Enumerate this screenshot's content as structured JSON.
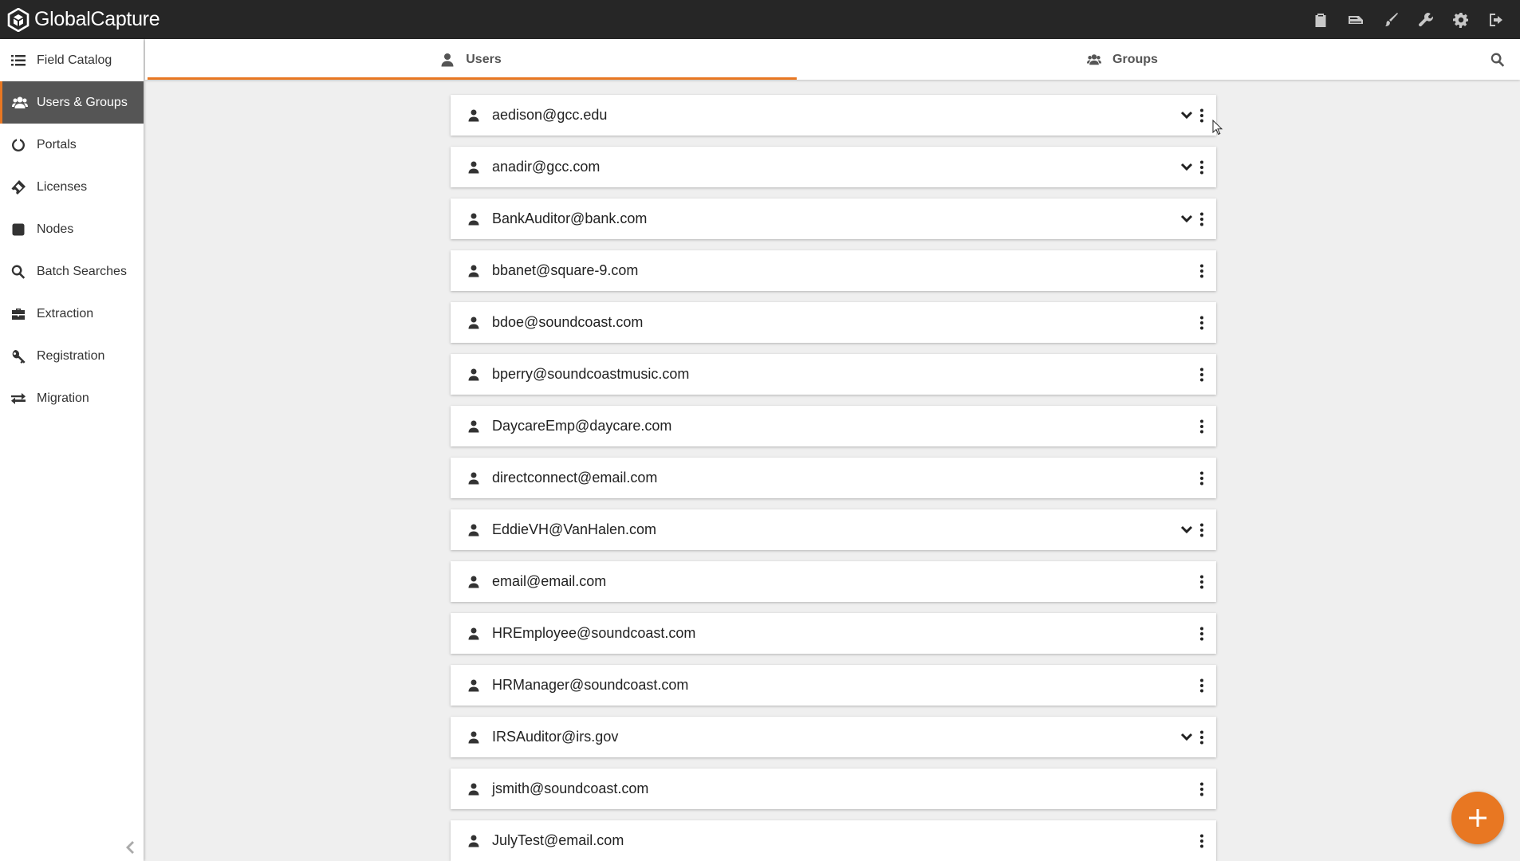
{
  "app": {
    "title": "GlobalCapture",
    "accent_color": "#e87722",
    "topbar_color": "#262626"
  },
  "toolbar": {
    "icons": [
      "clipboard-check-icon",
      "scanner-icon",
      "brush-icon",
      "wrench-icon",
      "gear-icon",
      "sign-out-icon"
    ]
  },
  "sidebar": {
    "items": [
      {
        "label": "Field Catalog",
        "icon": "list-icon"
      },
      {
        "label": "Users & Groups",
        "icon": "users-icon",
        "active": true
      },
      {
        "label": "Portals",
        "icon": "circle-notch-icon"
      },
      {
        "label": "Licenses",
        "icon": "ticket-icon"
      },
      {
        "label": "Nodes",
        "icon": "square-icon"
      },
      {
        "label": "Batch Searches",
        "icon": "search-icon"
      },
      {
        "label": "Extraction",
        "icon": "briefcase-icon"
      },
      {
        "label": "Registration",
        "icon": "key-icon"
      },
      {
        "label": "Migration",
        "icon": "exchange-icon"
      }
    ]
  },
  "tabs": [
    {
      "label": "Users",
      "icon": "user-icon",
      "active": true
    },
    {
      "label": "Groups",
      "icon": "users-icon",
      "active": false
    }
  ],
  "users": [
    {
      "email": "aedison@gcc.edu",
      "expandable": true
    },
    {
      "email": "anadir@gcc.com",
      "expandable": true
    },
    {
      "email": "BankAuditor@bank.com",
      "expandable": true
    },
    {
      "email": "bbanet@square-9.com",
      "expandable": false
    },
    {
      "email": "bdoe@soundcoast.com",
      "expandable": false
    },
    {
      "email": "bperry@soundcoastmusic.com",
      "expandable": false
    },
    {
      "email": "DaycareEmp@daycare.com",
      "expandable": false
    },
    {
      "email": "directconnect@email.com",
      "expandable": false
    },
    {
      "email": "EddieVH@VanHalen.com",
      "expandable": true
    },
    {
      "email": "email@email.com",
      "expandable": false
    },
    {
      "email": "HREmployee@soundcoast.com",
      "expandable": false
    },
    {
      "email": "HRManager@soundcoast.com",
      "expandable": false
    },
    {
      "email": "IRSAuditor@irs.gov",
      "expandable": true
    },
    {
      "email": "jsmith@soundcoast.com",
      "expandable": false
    },
    {
      "email": "JulyTest@email.com",
      "expandable": false
    }
  ]
}
